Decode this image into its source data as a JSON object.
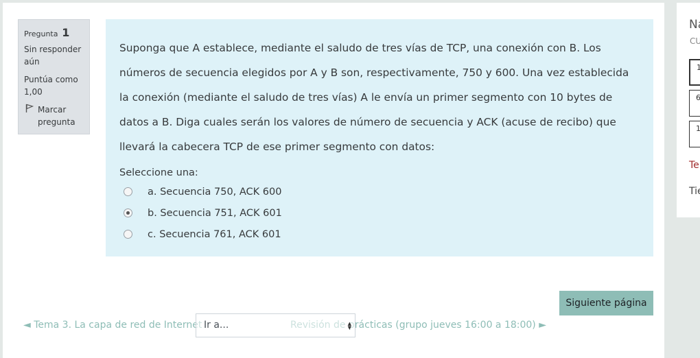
{
  "question_info": {
    "label": "Pregunta",
    "number": "1",
    "state": "Sin responder aún",
    "grade": "Puntúa como 1,00",
    "flag_label": "Marcar pregunta"
  },
  "question": {
    "text": "Suponga que A establece, mediante el saludo de tres vías de TCP, una conexión con B. Los números de secuencia elegidos por A y B son, respectivamente, 750 y 600. Una vez establecida la conexión (mediante el saludo de tres vías) A le envía un primer segmento con 10 bytes de datos a B. Diga cuales serán los valores de número de secuencia y ACK (acuse de recibo) que llevará la cabecera TCP de ese primer segmento con datos:",
    "prompt": "Seleccione una:",
    "answers": [
      {
        "label": "a. Secuencia 750, ACK 600",
        "selected": false
      },
      {
        "label": "b. Secuencia 751, ACK 601",
        "selected": true
      },
      {
        "label": "c. Secuencia 761, ACK 601",
        "selected": false
      }
    ]
  },
  "footer": {
    "next_button": "Siguiente página",
    "prev_link": "◄ Tema 3. La capa de red de Internet",
    "jump_select": "Ir a...",
    "next_link": "Revisión de prácticas (grupo jueves 16:00 a 18:00) ►"
  },
  "side": {
    "title": "Na",
    "subtitle": "CU",
    "buttons": [
      "1",
      "6",
      "1"
    ],
    "timer": "Te",
    "time": "Tie"
  },
  "colors": {
    "content_bg": "#def2f8",
    "info_bg": "#dee2e6",
    "accent": "#8ebdb6",
    "page_bg": "#e3e8e6",
    "timer_text": "#a02a2a"
  },
  "icons": {
    "flag": "flag-icon",
    "radio": "radio-button",
    "select_arrows": "chevron-up-down-icon"
  }
}
